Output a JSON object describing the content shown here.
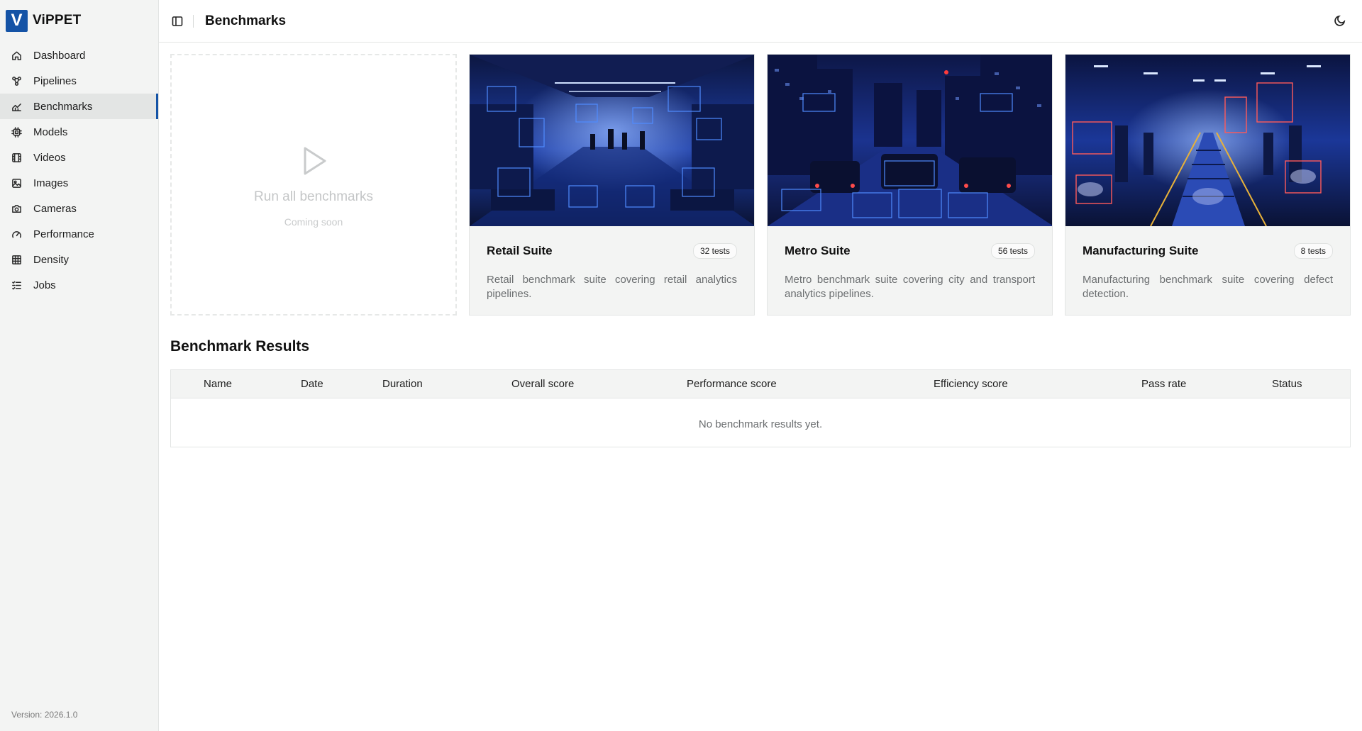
{
  "app": {
    "logo_letter": "V",
    "name": "ViPPET",
    "version": "Version: 2026.1.0"
  },
  "sidebar": {
    "items": [
      {
        "label": "Dashboard",
        "icon": "home-icon"
      },
      {
        "label": "Pipelines",
        "icon": "pipeline-icon"
      },
      {
        "label": "Benchmarks",
        "icon": "chart-line-icon",
        "active": true
      },
      {
        "label": "Models",
        "icon": "chip-icon"
      },
      {
        "label": "Videos",
        "icon": "film-icon"
      },
      {
        "label": "Images",
        "icon": "image-icon"
      },
      {
        "label": "Cameras",
        "icon": "camera-icon"
      },
      {
        "label": "Performance",
        "icon": "gauge-icon"
      },
      {
        "label": "Density",
        "icon": "grid-icon"
      },
      {
        "label": "Jobs",
        "icon": "list-checks-icon"
      }
    ]
  },
  "header": {
    "title": "Benchmarks"
  },
  "run_card": {
    "title": "Run all benchmarks",
    "subtitle": "Coming soon"
  },
  "suites": [
    {
      "name": "Retail Suite",
      "tests": "32 tests",
      "description": "Retail benchmark suite covering retail analytics pipelines."
    },
    {
      "name": "Metro Suite",
      "tests": "56 tests",
      "description": "Metro benchmark suite covering city and transport analytics pipelines."
    },
    {
      "name": "Manufacturing Suite",
      "tests": "8 tests",
      "description": "Manufacturing benchmark suite covering defect detection."
    }
  ],
  "results": {
    "title": "Benchmark Results",
    "columns": [
      "Name",
      "Date",
      "Duration",
      "Overall score",
      "Performance score",
      "Efficiency score",
      "Pass rate",
      "Status"
    ],
    "empty_text": "No benchmark results yet."
  },
  "colors": {
    "accent": "#1453a6",
    "sidebar_bg": "#f3f4f3",
    "image_blue": "#1a3b9e"
  }
}
